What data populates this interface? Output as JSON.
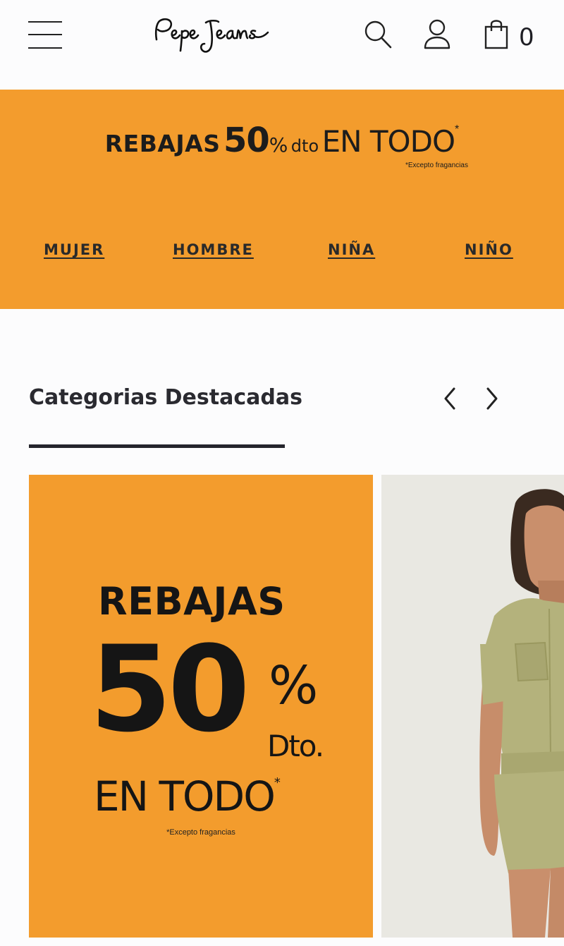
{
  "header": {
    "brand": "Pepe Jeans",
    "cart_count": "0",
    "icons": [
      "menu-icon",
      "search-icon",
      "user-icon",
      "shopping-bag-icon"
    ]
  },
  "promo_banner": {
    "word1": "REBAJAS",
    "percent": "50",
    "percent_sign": "%",
    "dto": "dto",
    "en_todo": "EN TODO",
    "asterisk": "*",
    "note": "*Excepto fragancias",
    "background": "#f39c2d",
    "categories": [
      {
        "label": "MUJER"
      },
      {
        "label": "HOMBRE"
      },
      {
        "label": "NIÑA"
      },
      {
        "label": "NIÑO"
      }
    ]
  },
  "featured": {
    "title": "Categorias Destacadas",
    "cards": [
      {
        "type": "promo",
        "rebajas": "REBAJAS",
        "number": "50",
        "percent_sign": "%",
        "dto": "Dto.",
        "en_todo": "EN TODO",
        "asterisk": "*",
        "note": "*Excepto fragancias"
      },
      {
        "type": "photo",
        "subject": "model-in-khaki-shirt-and-shorts"
      }
    ]
  },
  "colors": {
    "accent_orange": "#f39c2d",
    "text_dark": "#1e1e24",
    "background": "#fcfcfd"
  }
}
